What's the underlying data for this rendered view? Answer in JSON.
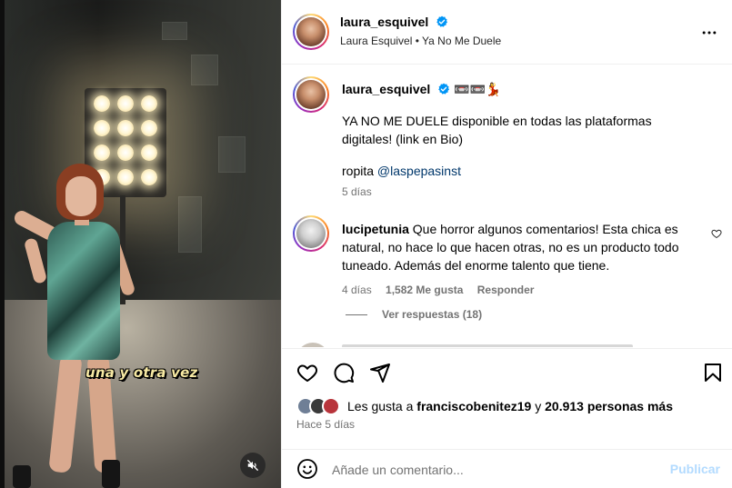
{
  "media": {
    "caption_overlay": "una y otra vez",
    "mute_icon": "speaker-muted-icon"
  },
  "header": {
    "username": "laura_esquivel",
    "subtitle": "Laura Esquivel • Ya No Me Duele",
    "more_icon": "more-horizontal-icon"
  },
  "post_caption": {
    "username": "laura_esquivel",
    "emoji": "📼📼💃",
    "line1": "YA NO ME DUELE disponible en todas las plataformas",
    "line2": "digitales! (link en Bio)",
    "ropita_prefix": "ropita ",
    "mention": "@laspepasinst",
    "time": "5 días"
  },
  "comment": {
    "username": "lucipetunia",
    "text_line1": "Que horror algunos comentarios! Esta chica es",
    "text_line2": "natural, no hace lo que hacen otras, no es un producto todo",
    "text_line3": "tuneado. Además del enorme talento que tiene.",
    "time": "4 días",
    "likes": "1,582 Me gusta",
    "reply": "Responder",
    "view_replies": "Ver respuestas (18)"
  },
  "likes": {
    "prefix": "Les gusta a ",
    "user": "franciscobenitez19",
    "middle": " y ",
    "count": "20.913 personas más",
    "time": "Hace 5 días"
  },
  "comment_box": {
    "placeholder": "Añade un comentario...",
    "publish": "Publicar"
  },
  "colors": {
    "verified": "#0095f6",
    "publish_disabled": "#b3dbff",
    "muted_text": "#737373",
    "mention": "#00376b"
  }
}
